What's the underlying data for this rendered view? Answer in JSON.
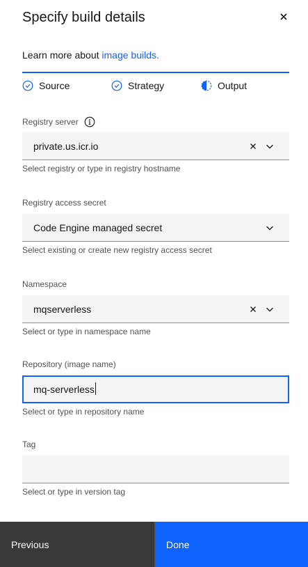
{
  "header": {
    "title": "Specify build details",
    "close_icon": "close-icon"
  },
  "intro": {
    "text": "Learn more about ",
    "link": "image builds."
  },
  "progress": {
    "steps": [
      {
        "label": "Source",
        "state": "complete",
        "icon": "checkmark-outline-icon"
      },
      {
        "label": "Strategy",
        "state": "complete",
        "icon": "checkmark-outline-icon"
      },
      {
        "label": "Output",
        "state": "current",
        "icon": "incomplete-icon"
      }
    ]
  },
  "fields": {
    "registry_server": {
      "label": "Registry server",
      "value": "private.us.icr.io",
      "helper": "Select registry or type in registry hostname"
    },
    "registry_secret": {
      "label": "Registry access secret",
      "value": "Code Engine managed secret",
      "helper": "Select existing or create new registry access secret"
    },
    "namespace": {
      "label": "Namespace",
      "value": "mqserverless",
      "helper": "Select or type in namespace name"
    },
    "repository": {
      "label": "Repository (image name)",
      "value": "mq-serverless",
      "helper": "Select or type in repository name"
    },
    "tag": {
      "label": "Tag",
      "value": "",
      "helper": "Select or type in version tag"
    }
  },
  "footer": {
    "previous_label": "Previous",
    "done_label": "Done"
  },
  "colors": {
    "accent": "#0f62fe",
    "field_bg": "#f4f4f4",
    "secondary_button": "#393939"
  }
}
